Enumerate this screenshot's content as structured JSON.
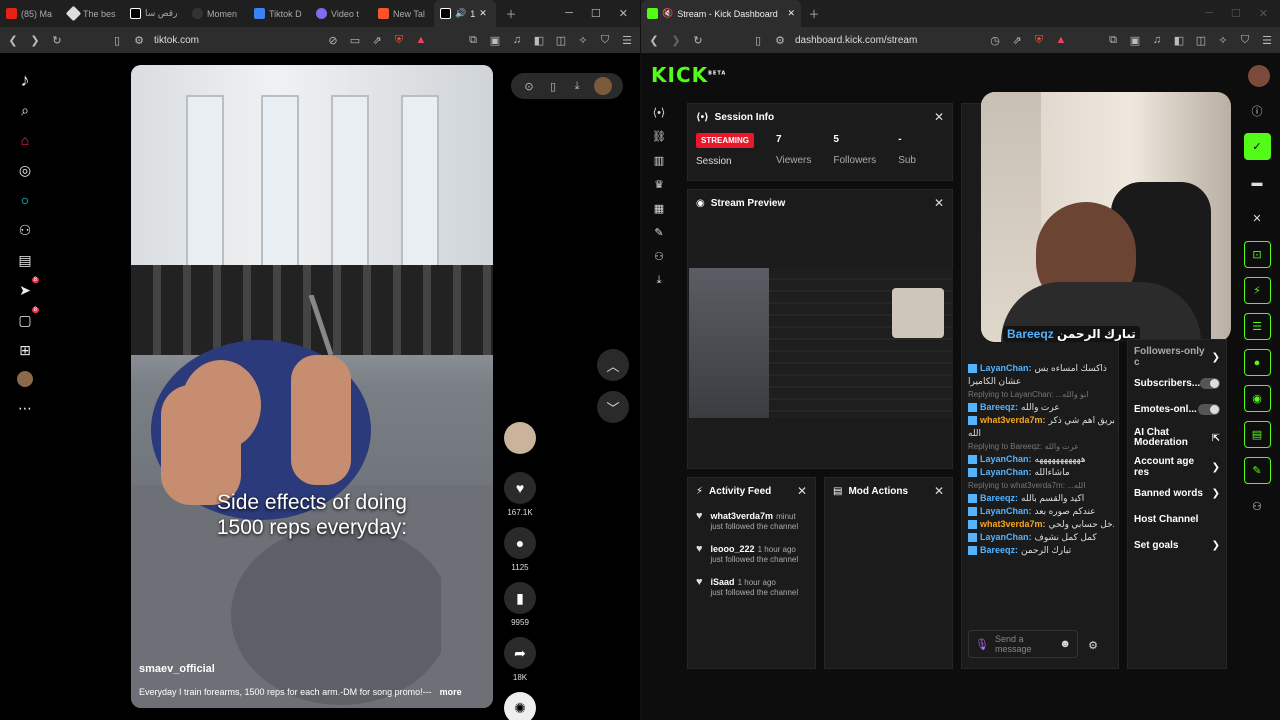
{
  "left_browser": {
    "tabs": [
      "(85) Ma",
      "The bes",
      "رقص سا",
      "Momen",
      "Tiktok D",
      "Video t",
      "New Tal",
      "1"
    ],
    "url": "tiktok.com"
  },
  "tiktok": {
    "caption_line1": "Side effects of doing",
    "caption_line2": "1500 reps everyday:",
    "username": "smaev_official",
    "description": "Everyday I train forearms, 1500 reps for each arm.-DM for song promo!---",
    "more": "more",
    "likes": "167.1K",
    "comments": "1125",
    "saves": "9959",
    "shares": "18K",
    "sidebar_badges": [
      "8",
      "8"
    ]
  },
  "right_browser": {
    "tab_title": "Stream - Kick Dashboard",
    "url": "dashboard.kick.com/stream"
  },
  "kick": {
    "logo": "KICK",
    "logo_sup": "BETA",
    "session": {
      "title": "Session Info",
      "badge": "STREAMING",
      "session_label": "Session",
      "viewers_value": "7",
      "viewers_label": "Viewers",
      "followers_value": "5",
      "followers_label": "Followers",
      "subs_value": "-",
      "subs_label": "Sub"
    },
    "preview_title": "Stream Preview",
    "activity": {
      "title": "Activity Feed",
      "items": [
        {
          "name": "what3verda7m",
          "time": "minut",
          "text": "just followed the channel"
        },
        {
          "name": "leooo_222",
          "time": "1 hour ago",
          "text": "just followed the channel"
        },
        {
          "name": "iSaad",
          "time": "1 hour ago",
          "text": "just followed the channel"
        }
      ]
    },
    "mod_title": "Mod Actions",
    "chat": {
      "overlay_name": "Bareeqz",
      "overlay_text": "تبارك الرحمن",
      "lines": [
        {
          "kind": "msg",
          "user": "LayanChan:",
          "text": "ذاكسك امساءه بس",
          "cls": ""
        },
        {
          "kind": "plain",
          "text": "عشان الكاميرا"
        },
        {
          "kind": "reply",
          "text": "Replying to LayanChan: ...ابو والله"
        },
        {
          "kind": "msg",
          "user": "Bareeqz:",
          "text": "عرت والله",
          "cls": ""
        },
        {
          "kind": "msg",
          "user": "what3verda7m:",
          "text": "يابريق اهم شي ذكر",
          "cls": "o"
        },
        {
          "kind": "plain",
          "text": "الله"
        },
        {
          "kind": "reply",
          "text": "Replying to Bareeqz: عرت والله"
        },
        {
          "kind": "msg",
          "user": "LayanChan:",
          "text": "هههههههههههه",
          "cls": ""
        },
        {
          "kind": "msg",
          "user": "LayanChan:",
          "text": "ماشاءالله",
          "cls": ""
        },
        {
          "kind": "reply",
          "text": "Replying to what3verda7m: ...الله"
        },
        {
          "kind": "msg",
          "user": "Bareeqz:",
          "text": "اكيد والقسم بالله",
          "cls": ""
        },
        {
          "kind": "msg",
          "user": "LayanChan:",
          "text": "عندكم صوره بعد",
          "cls": ""
        },
        {
          "kind": "msg",
          "user": "what3verda7m:",
          "text": "ادخل حسابي ولحي",
          "cls": "o"
        },
        {
          "kind": "msg",
          "user": "LayanChan:",
          "text": "كمل كمل نشوف",
          "cls": ""
        },
        {
          "kind": "msg",
          "user": "Bareeqz:",
          "text": "تبارك الرحمن",
          "cls": ""
        }
      ],
      "placeholder": "Send a message"
    },
    "settings": {
      "followers_only": "Followers-only c",
      "subscribers": "Subscribers...",
      "emotes": "Emotes-onl...",
      "ai_mod_1": "AI Chat",
      "ai_mod_2": "Moderation",
      "account_age": "Account age res",
      "banned": "Banned words",
      "host": "Host Channel",
      "goals": "Set goals"
    }
  },
  "colors": {
    "kick_green": "#53fc18",
    "streaming_red": "#e9172b",
    "tiktok_pink": "#fe2c55"
  }
}
